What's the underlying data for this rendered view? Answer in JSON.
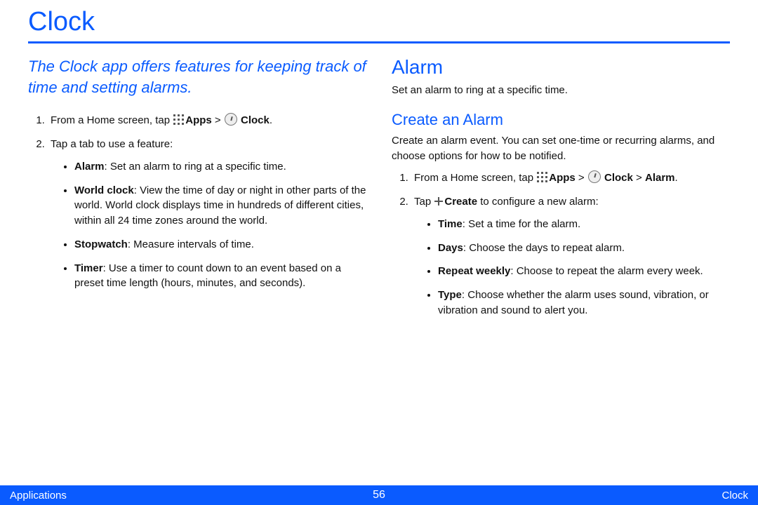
{
  "title": "Clock",
  "intro": "The Clock app offers features for keeping track of time and setting alarms.",
  "left": {
    "step1_pre": "From a Home screen, tap ",
    "apps_label": "Apps",
    "gt": " > ",
    "clock_label": "Clock",
    "period": ".",
    "step2": "Tap a tab to use a feature:",
    "bullets": {
      "alarm_label": "Alarm",
      "alarm_text": ": Set an alarm to ring at a specific time.",
      "world_label": "World clock",
      "world_text": ": View the time of day or night in other parts of the world. World clock displays time in hundreds of different cities, within all 24 time zones around the world.",
      "stopwatch_label": "Stopwatch",
      "stopwatch_text": ": Measure intervals of time.",
      "timer_label": "Timer",
      "timer_text": ": Use a timer to count down to an event based on a preset time length (hours, minutes, and seconds)."
    }
  },
  "right": {
    "alarm_heading": "Alarm",
    "alarm_intro": "Set an alarm to ring at a specific time.",
    "create_heading": "Create an Alarm",
    "create_intro": "Create an alarm event. You can set one-time or recurring alarms, and choose options for how to be notified.",
    "step1_pre": "From a Home screen, tap ",
    "apps_label": "Apps",
    "gt1": " > ",
    "clock_label": "Clock",
    "gt2": " > ",
    "alarm_label": "Alarm",
    "period": ".",
    "step2_pre": "Tap ",
    "create_label": "Create",
    "step2_post": "  to configure a new alarm:",
    "bullets": {
      "time_label": "Time",
      "time_text": ": Set a time for the alarm.",
      "days_label": "Days",
      "days_text": ": Choose the days to repeat alarm.",
      "repeat_label": "Repeat weekly",
      "repeat_text": ": Choose to repeat the alarm every week.",
      "type_label": "Type",
      "type_text": ": Choose whether the alarm uses sound, vibration, or vibration and sound to alert you."
    }
  },
  "footer": {
    "left": "Applications",
    "center": "56",
    "right": "Clock"
  }
}
